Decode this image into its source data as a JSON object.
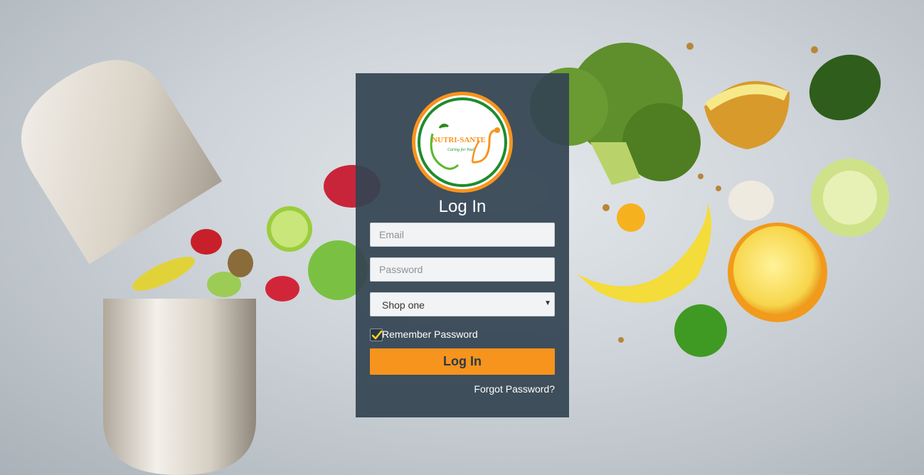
{
  "brand": {
    "logo_name": "NUTRI-SANTE",
    "logo_tagline": "Caring for You!",
    "colors": {
      "accent": "#f7941d",
      "green": "#1e8c2e",
      "panel": "#344452"
    }
  },
  "login": {
    "title": "Log In",
    "email_placeholder": "Email",
    "password_placeholder": "Password",
    "shop_select_value": "Shop one",
    "remember_label": "Remember Password",
    "remember_checked": true,
    "submit_label": "Log In",
    "forgot_label": "Forgot Password?"
  }
}
